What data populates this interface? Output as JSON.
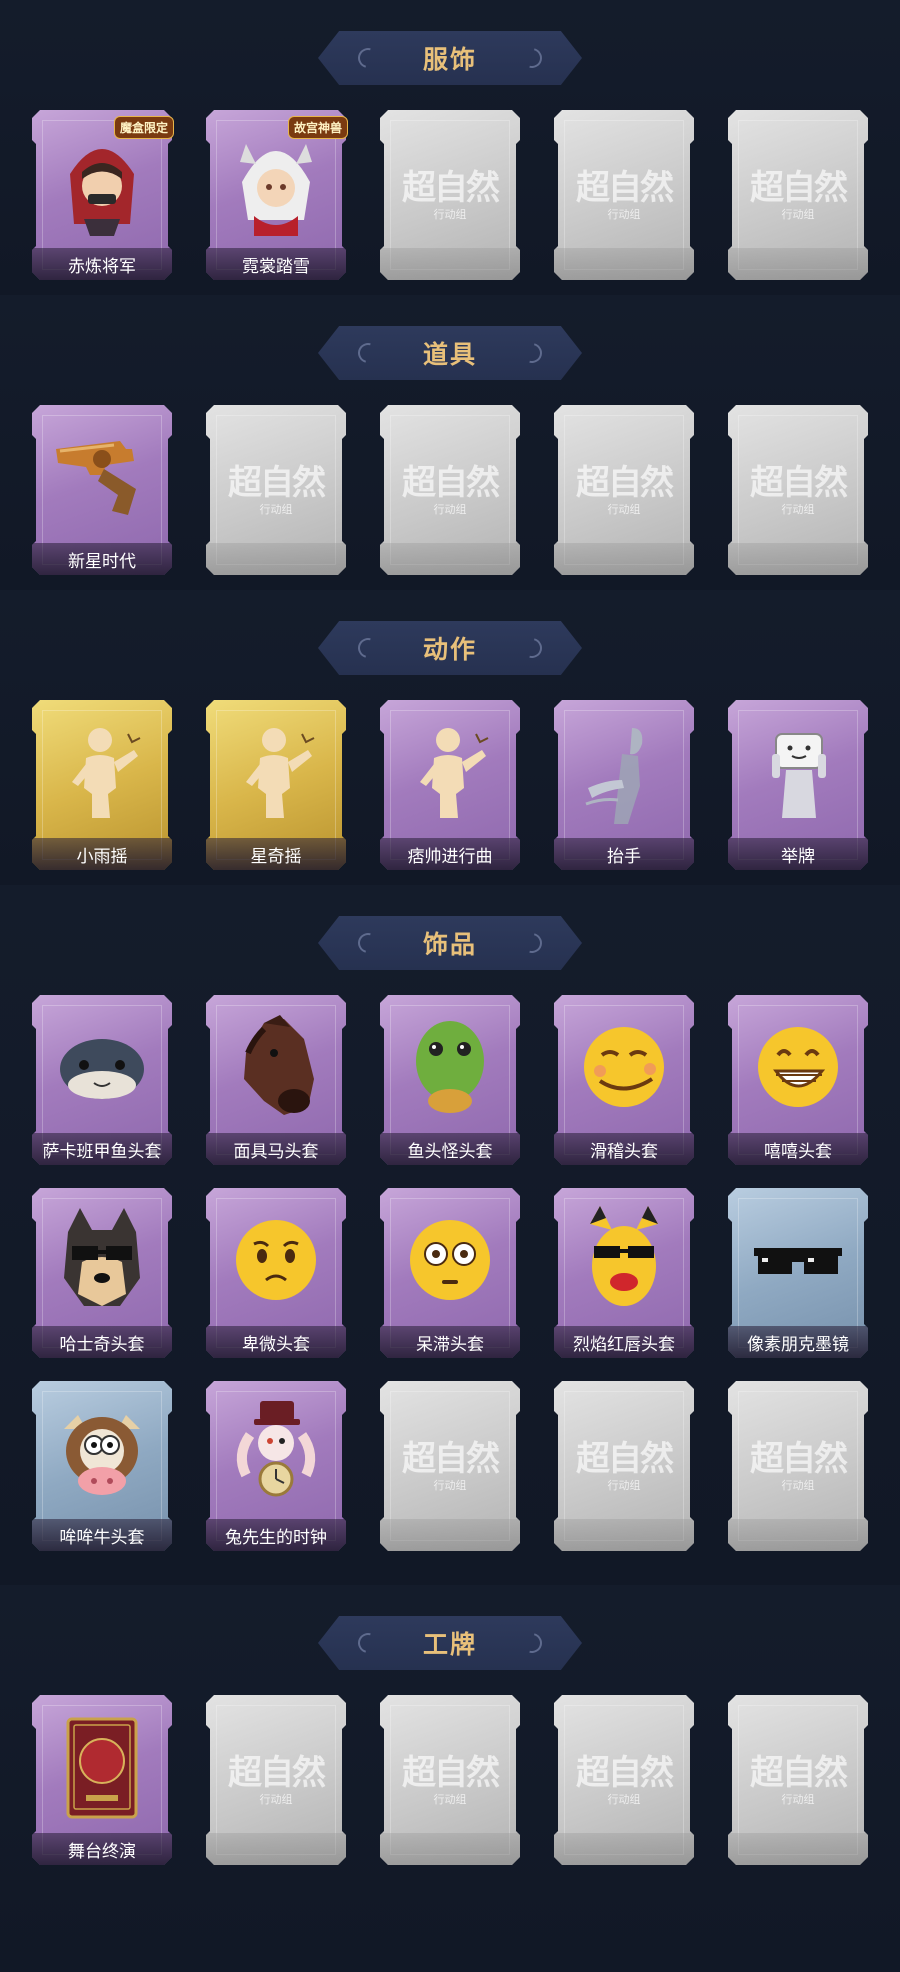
{
  "sections": [
    {
      "title": "服饰",
      "items": [
        {
          "label": "赤炼将军",
          "kind": "purple",
          "icon": "red-hood-character-icon",
          "badge": "魔盒限定"
        },
        {
          "label": "霓裳踏雪",
          "kind": "purple",
          "icon": "white-hair-character-icon",
          "badge": "故宫神兽"
        },
        {
          "label": "",
          "kind": "empty",
          "icon": "empty-slot-icon"
        },
        {
          "label": "",
          "kind": "empty",
          "icon": "empty-slot-icon"
        },
        {
          "label": "",
          "kind": "empty",
          "icon": "empty-slot-icon"
        }
      ]
    },
    {
      "title": "道具",
      "items": [
        {
          "label": "新星时代",
          "kind": "purple",
          "icon": "revolver-icon"
        },
        {
          "label": "",
          "kind": "empty",
          "icon": "empty-slot-icon"
        },
        {
          "label": "",
          "kind": "empty",
          "icon": "empty-slot-icon"
        },
        {
          "label": "",
          "kind": "empty",
          "icon": "empty-slot-icon"
        },
        {
          "label": "",
          "kind": "empty",
          "icon": "empty-slot-icon"
        }
      ]
    },
    {
      "title": "动作",
      "items": [
        {
          "label": "小雨摇",
          "kind": "gold",
          "icon": "dance-pose-icon"
        },
        {
          "label": "星奇摇",
          "kind": "gold",
          "icon": "dance-pose-icon"
        },
        {
          "label": "痞帅进行曲",
          "kind": "purple",
          "icon": "dance-pose-icon"
        },
        {
          "label": "抬手",
          "kind": "purple",
          "icon": "raise-hand-icon"
        },
        {
          "label": "举牌",
          "kind": "purple",
          "icon": "hold-sign-icon"
        }
      ]
    },
    {
      "title": "饰品",
      "items": [
        {
          "label": "萨卡班甲鱼头套",
          "kind": "purple",
          "icon": "fish-head-icon"
        },
        {
          "label": "面具马头套",
          "kind": "purple",
          "icon": "horse-mask-icon"
        },
        {
          "label": "鱼头怪头套",
          "kind": "purple",
          "icon": "green-fish-mask-icon"
        },
        {
          "label": "滑稽头套",
          "kind": "purple",
          "icon": "smirk-emoji-icon"
        },
        {
          "label": "嘻嘻头套",
          "kind": "purple",
          "icon": "grin-emoji-icon"
        },
        {
          "label": "哈士奇头套",
          "kind": "purple",
          "icon": "husky-sunglasses-icon"
        },
        {
          "label": "卑微头套",
          "kind": "purple",
          "icon": "pleading-emoji-icon"
        },
        {
          "label": "呆滞头套",
          "kind": "purple",
          "icon": "flushed-emoji-icon"
        },
        {
          "label": "烈焰红唇头套",
          "kind": "purple",
          "icon": "yellow-mask-sunglasses-icon"
        },
        {
          "label": "像素朋克墨镜",
          "kind": "blue",
          "icon": "pixel-sunglasses-icon"
        },
        {
          "label": "哞哞牛头套",
          "kind": "blue",
          "icon": "cow-head-icon"
        },
        {
          "label": "兔先生的时钟",
          "kind": "purple",
          "icon": "rabbit-clock-icon"
        },
        {
          "label": "",
          "kind": "empty",
          "icon": "empty-slot-icon"
        },
        {
          "label": "",
          "kind": "empty",
          "icon": "empty-slot-icon"
        },
        {
          "label": "",
          "kind": "empty",
          "icon": "empty-slot-icon"
        }
      ]
    },
    {
      "title": "工牌",
      "items": [
        {
          "label": "舞台终演",
          "kind": "purple",
          "icon": "badge-card-icon"
        },
        {
          "label": "",
          "kind": "empty",
          "icon": "empty-slot-icon"
        },
        {
          "label": "",
          "kind": "empty",
          "icon": "empty-slot-icon"
        },
        {
          "label": "",
          "kind": "empty",
          "icon": "empty-slot-icon"
        },
        {
          "label": "",
          "kind": "empty",
          "icon": "empty-slot-icon"
        }
      ]
    }
  ],
  "placeholder_watermark": {
    "title": "超自然",
    "subtitle": "行动组"
  },
  "colors": {
    "background": "#111826",
    "header_text": "#e8c07a",
    "header_banner": "#2e3a5c",
    "purple_card": "#a27bbd",
    "gold_card": "#d9b64a",
    "blue_card": "#8fa9c2",
    "empty_card": "#c9c9c9"
  }
}
